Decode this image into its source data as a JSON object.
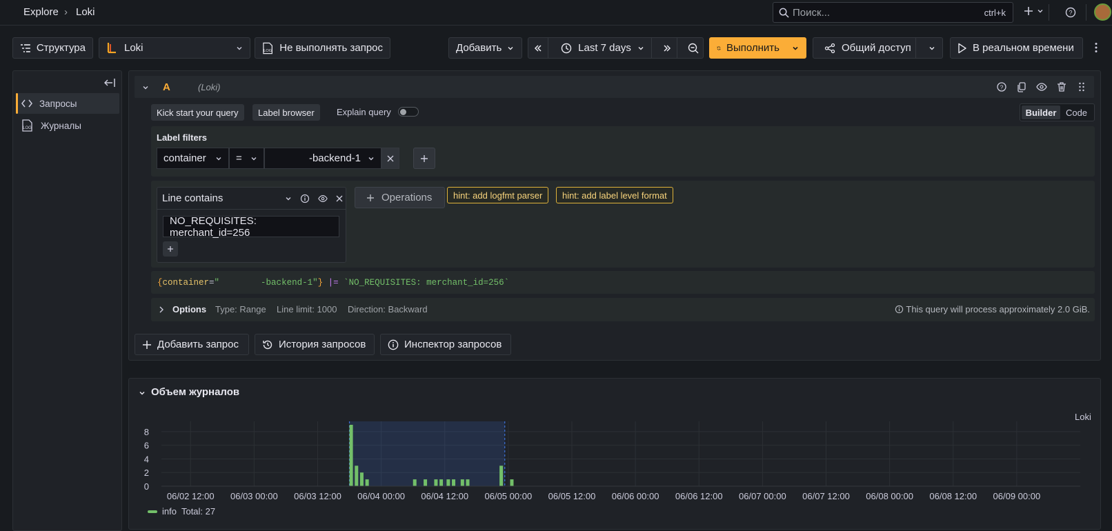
{
  "breadcrumb": {
    "root": "Explore",
    "separator": "›",
    "current": "Loki"
  },
  "search": {
    "placeholder": "Поиск...",
    "shortcut": "ctrl+k"
  },
  "toolbar": {
    "outline_label": "Структура",
    "datasource": "Loki",
    "no_run_label": "Не выполнять запрос",
    "add_label": "Добавить",
    "time_range": "Last 7 days",
    "run_label": "Выполнить",
    "share_label": "Общий доступ",
    "live_label": "В реальном времени"
  },
  "sidenav": {
    "items": [
      {
        "label": "Запросы",
        "icon": "code-icon"
      },
      {
        "label": "Журналы",
        "icon": "logs-icon"
      }
    ]
  },
  "query": {
    "ref_id": "A",
    "datasource_tag": "(Loki)",
    "kick_start": "Kick start your query",
    "label_browser": "Label browser",
    "explain_label": "Explain query",
    "mode_builder": "Builder",
    "mode_code": "Code",
    "label_filters_title": "Label filters",
    "label_name": "container",
    "operator": "=",
    "label_value": "-backend-1",
    "operation_title": "Line contains",
    "operation_value": "NO_REQUISITES: merchant_id=256",
    "operations_button": "Operations",
    "hints": [
      "hint: add logfmt parser",
      "hint: add label level format"
    ],
    "raw": {
      "open": "{",
      "key": "container",
      "eq": "=",
      "value": "\"        -backend-1\"",
      "close": "}",
      "pipe": "|=",
      "text": "`NO_REQUISITES: merchant_id=256`"
    },
    "options": {
      "title": "Options",
      "type": "Type: Range",
      "limit": "Line limit: 1000",
      "direction": "Direction: Backward",
      "estimate": "This query will process approximately 2.0 GiB."
    }
  },
  "actions": {
    "add_query": "Добавить запрос",
    "history": "История запросов",
    "inspector": "Инспектор запросов"
  },
  "volume": {
    "title": "Объем журналов",
    "datasource": "Loki",
    "legend_name": "info",
    "legend_total": "Total: 27"
  },
  "colors": {
    "accent": "#fbad37",
    "series": "#73bf69",
    "selection": "#3d71d9"
  },
  "chart_data": {
    "type": "bar",
    "ylim": [
      0,
      9
    ],
    "yticks": [
      "8",
      "6",
      "4",
      "2",
      "0"
    ],
    "xticks": [
      "06/02 12:00",
      "06/03 00:00",
      "06/03 12:00",
      "06/04 00:00",
      "06/04 12:00",
      "06/05 00:00",
      "06/05 12:00",
      "06/06 00:00",
      "06/06 12:00",
      "06/07 00:00",
      "06/07 12:00",
      "06/08 00:00",
      "06/08 12:00",
      "06/09 00:00"
    ],
    "series": [
      {
        "name": "info",
        "points": [
          [
            "06/03 18:20",
            9
          ],
          [
            "06/03 19:20",
            3
          ],
          [
            "06/03 20:20",
            2
          ],
          [
            "06/03 21:20",
            1
          ],
          [
            "06/04 06:20",
            1
          ],
          [
            "06/04 08:20",
            1
          ],
          [
            "06/04 10:20",
            1
          ],
          [
            "06/04 11:20",
            1
          ],
          [
            "06/04 12:40",
            1
          ],
          [
            "06/04 13:40",
            1
          ],
          [
            "06/04 15:20",
            1
          ],
          [
            "06/04 16:20",
            1
          ],
          [
            "06/04 22:40",
            3
          ],
          [
            "06/05 00:40",
            1
          ]
        ]
      }
    ],
    "selection": [
      "06/03 18:00",
      "06/04 23:20"
    ],
    "grid": true,
    "legend": "bottom-left"
  }
}
